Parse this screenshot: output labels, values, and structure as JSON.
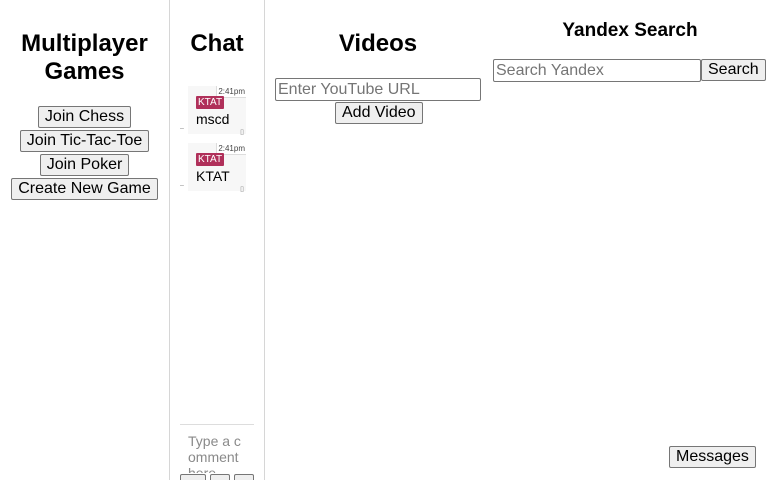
{
  "games": {
    "title": "Multiplayer Games",
    "buttons": [
      {
        "label": "Join Chess"
      },
      {
        "label": "Join Tic-Tac-Toe"
      },
      {
        "label": "Join Poker"
      },
      {
        "label": "Create New Game"
      }
    ]
  },
  "chat": {
    "title": "Chat",
    "messages": [
      {
        "time": "2:41pm",
        "user": "KTAT",
        "text": "mscd"
      },
      {
        "time": "2:41pm",
        "user": "KTAT",
        "text": "KTAT"
      }
    ],
    "input_placeholder": "Type a comment here...",
    "input_visible": "Type a comment here"
  },
  "videos": {
    "title": "Videos",
    "url_placeholder": "Enter YouTube URL",
    "add_label": "Add Video"
  },
  "yandex": {
    "title": "Yandex Search",
    "search_placeholder": "Search Yandex",
    "search_label": "Search"
  },
  "messages_label": "Messages",
  "colors": {
    "badge": "#b0305a",
    "button_bg": "#efefef",
    "border": "#767676"
  }
}
